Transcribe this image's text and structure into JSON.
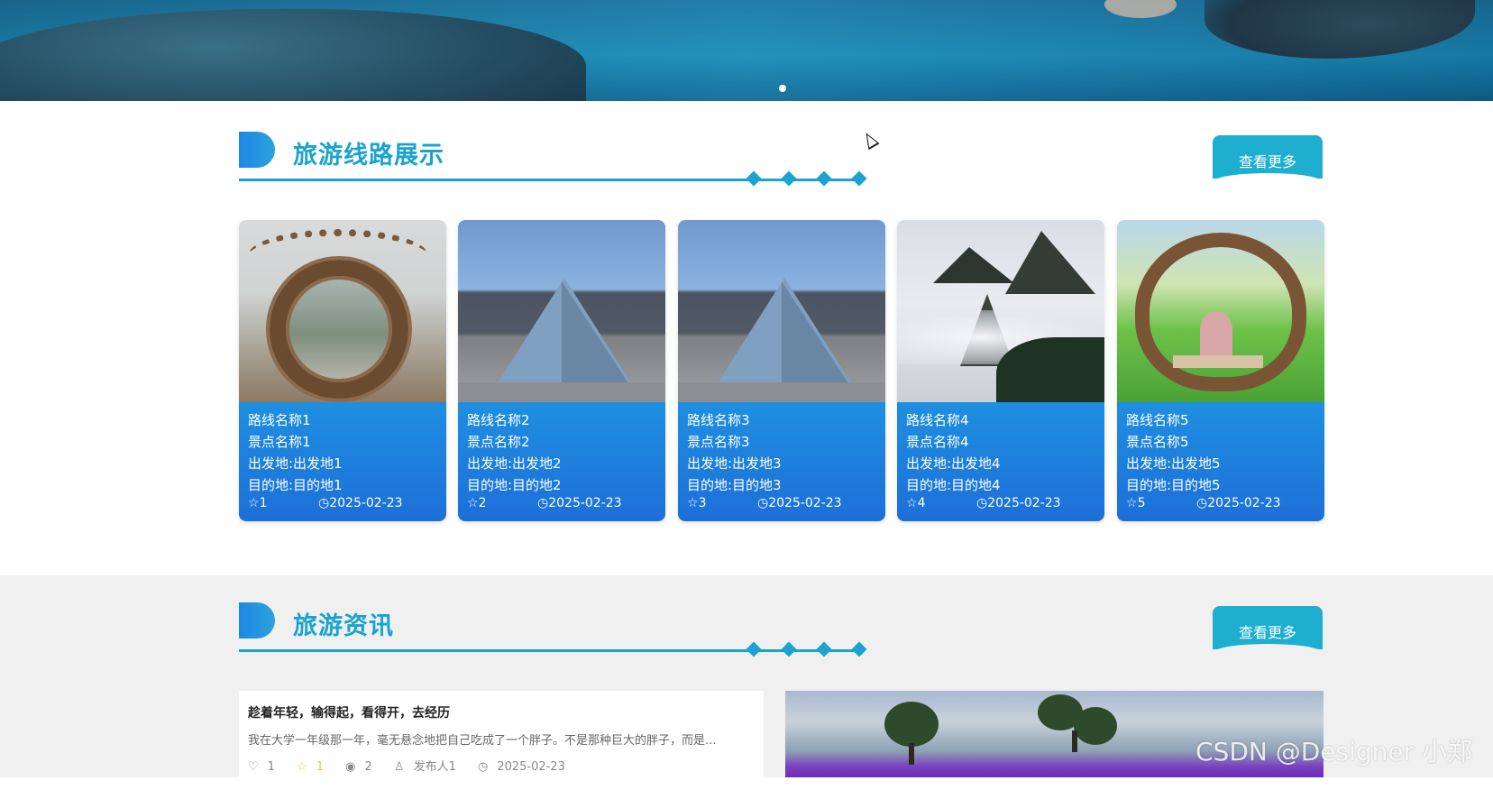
{
  "banner": {
    "carousel_dots": 1
  },
  "routes_section": {
    "title": "旅游线路展示",
    "more_label": "查看更多",
    "cards": [
      {
        "route": "路线名称1",
        "spot": "景点名称1",
        "from": "出发地:出发地1",
        "to": "目的地:目的地1",
        "favorites": "1",
        "date": "2025-02-23",
        "image": "woven-ring-sculpture"
      },
      {
        "route": "路线名称2",
        "spot": "景点名称2",
        "from": "出发地:出发地2",
        "to": "目的地:目的地2",
        "favorites": "2",
        "date": "2025-02-23",
        "image": "glass-pyramid"
      },
      {
        "route": "路线名称3",
        "spot": "景点名称3",
        "from": "出发地:出发地3",
        "to": "目的地:目的地3",
        "favorites": "3",
        "date": "2025-02-23",
        "image": "glass-pyramid"
      },
      {
        "route": "路线名称4",
        "spot": "景点名称4",
        "from": "出发地:出发地4",
        "to": "目的地:目的地4",
        "favorites": "4",
        "date": "2025-02-23",
        "image": "misty-mountains"
      },
      {
        "route": "路线名称5",
        "spot": "景点名称5",
        "from": "出发地:出发地5",
        "to": "目的地:目的地5",
        "favorites": "5",
        "date": "2025-02-23",
        "image": "heart-swing"
      }
    ]
  },
  "news_section": {
    "title": "旅游资讯",
    "more_label": "查看更多",
    "item": {
      "title": "趁着年轻，输得起，看得开，去经历",
      "excerpt": "我在大学一年级那一年，毫无悬念地把自己吃成了一个胖子。不是那种巨大的胖子，而是...",
      "likes": "1",
      "favorites": "1",
      "views": "2",
      "publisher": "发布人1",
      "date": "2025-02-23"
    },
    "image": "lavender-field-trees"
  },
  "watermark": "CSDN @Designer 小郑",
  "colors": {
    "accent": "#1aa3d0",
    "card_blue": "#1e8fe0",
    "section_gray": "#f0f0f0"
  }
}
